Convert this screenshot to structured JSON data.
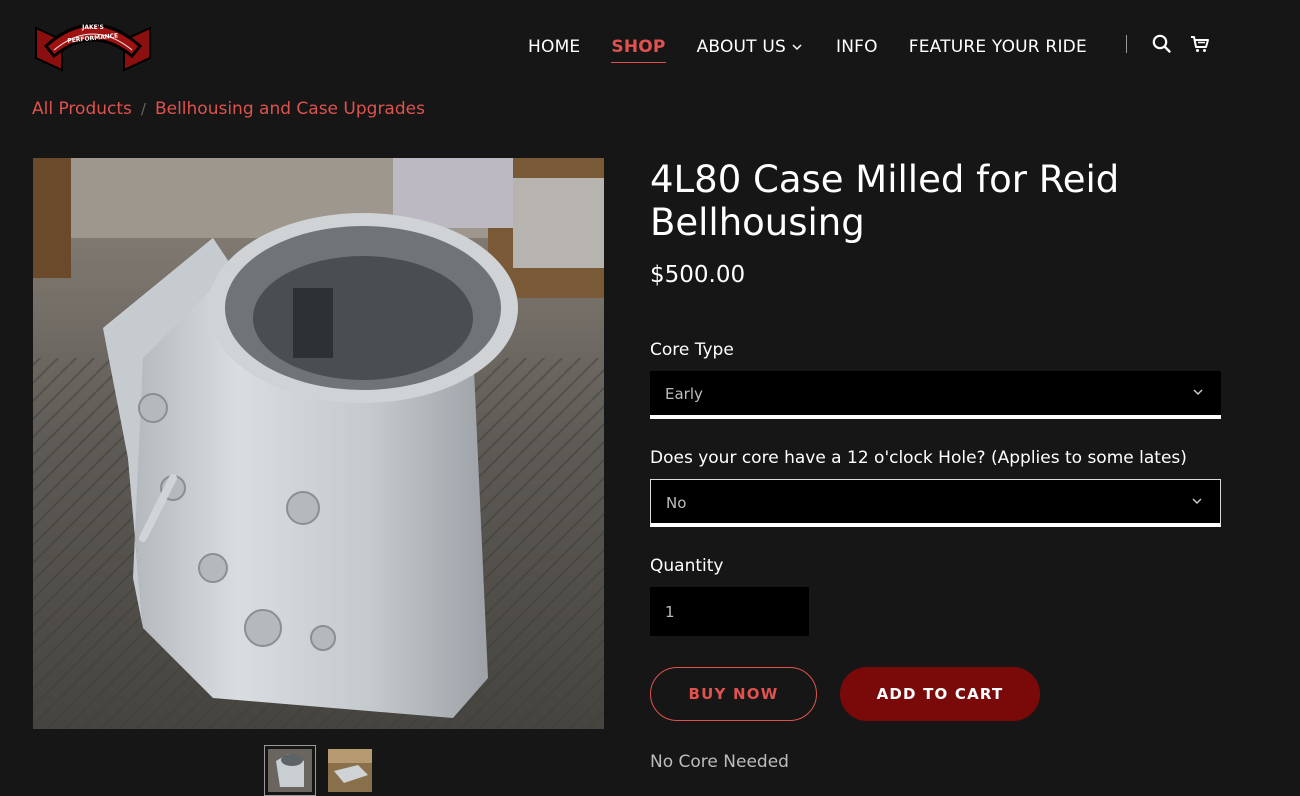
{
  "brand": {
    "logo_text_line1": "JAKE'S",
    "logo_text_line2": "PERFORMANCE"
  },
  "nav": {
    "items": [
      {
        "label": "HOME",
        "active": false
      },
      {
        "label": "SHOP",
        "active": true
      },
      {
        "label": "ABOUT US",
        "active": false,
        "has_dropdown": true
      },
      {
        "label": "INFO",
        "active": false
      },
      {
        "label": "FEATURE YOUR RIDE",
        "active": false
      }
    ],
    "icons": [
      "search-icon",
      "cart-icon"
    ]
  },
  "breadcrumb": {
    "items": [
      "All Products",
      "Bellhousing and Case Upgrades"
    ],
    "separator": "/"
  },
  "product": {
    "title": "4L80 Case Milled for Reid Bellhousing",
    "price": "$500.00",
    "options": [
      {
        "label": "Core Type",
        "value": "Early"
      },
      {
        "label": "Does your core have a 12 o'clock Hole? (Applies to some lates)",
        "value": "No"
      }
    ],
    "quantity": {
      "label": "Quantity",
      "value": "1"
    },
    "buy_now_label": "BUY NOW",
    "add_to_cart_label": "ADD TO CART",
    "note": "No Core Needed",
    "thumbnail_count": 2,
    "selected_thumbnail": 1
  },
  "colors": {
    "background": "#161616",
    "accent": "#e0524d",
    "cart_button": "#7a0a0a",
    "text": "#ffffff",
    "muted_text": "#bdbdbd"
  }
}
